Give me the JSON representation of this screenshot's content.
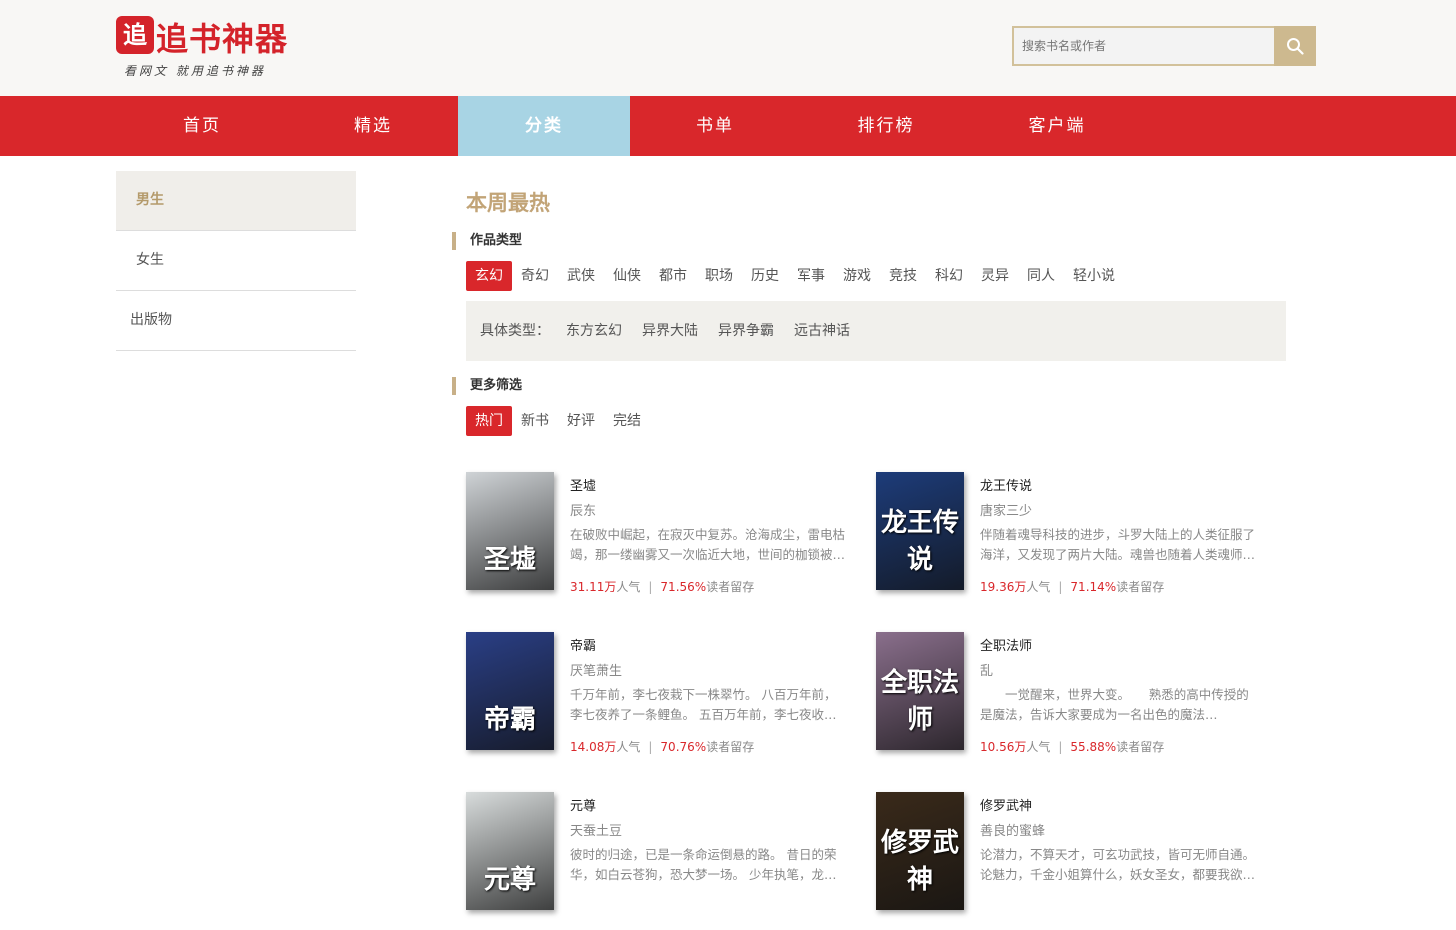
{
  "header": {
    "logo_mark": "追",
    "logo_text": "追书神器",
    "slogan": "看网文 就用追书神器",
    "search_placeholder": "搜索书名或作者"
  },
  "nav": {
    "items": [
      {
        "label": "首页"
      },
      {
        "label": "精选"
      },
      {
        "label": "分类",
        "active": true
      },
      {
        "label": "书单"
      },
      {
        "label": "排行榜"
      },
      {
        "label": "客户端"
      }
    ]
  },
  "sidebar": {
    "items": [
      {
        "label": "男生",
        "active": true
      },
      {
        "label": "女生"
      },
      {
        "label": "出版物"
      }
    ]
  },
  "main": {
    "title": "本周最热",
    "genre_section": "作品类型",
    "genres": [
      "玄幻",
      "奇幻",
      "武侠",
      "仙侠",
      "都市",
      "职场",
      "历史",
      "军事",
      "游戏",
      "竞技",
      "科幻",
      "灵异",
      "同人",
      "轻小说"
    ],
    "active_genre": "玄幻",
    "sub_label": "具体类型：",
    "sub_types": [
      "东方玄幻",
      "异界大陆",
      "异界争霸",
      "远古神话"
    ],
    "filter_section": "更多筛选",
    "filters": [
      "热门",
      "新书",
      "好评",
      "完结"
    ],
    "active_filter": "热门"
  },
  "books": [
    {
      "title": "圣墟",
      "author": "辰东",
      "desc": "在破败中崛起，在寂灭中复苏。沧海成尘，雷电枯竭，那一缕幽雾又一次临近大地，世间的枷锁被打…",
      "popularity": "31.11万",
      "pop_label": "人气",
      "retention": "71.56%",
      "ret_label": "读者留存",
      "cover_text": "圣墟",
      "cover_color": "#cfd3d6"
    },
    {
      "title": "龙王传说",
      "author": "唐家三少",
      "desc": "伴随着魂导科技的进步，斗罗大陆上的人类征服了海洋，又发现了两片大陆。魂兽也随着人类魂师的…",
      "popularity": "19.36万",
      "pop_label": "人气",
      "retention": "71.14%",
      "ret_label": "读者留存",
      "cover_text": "龙王传说",
      "cover_color": "#1d3c7a"
    },
    {
      "title": "帝霸",
      "author": "厌笔萧生",
      "desc": "千万年前，李七夜栽下一株翠竹。 八百万年前，李七夜养了一条鲤鱼。 五百万年前，李七夜收养一个…",
      "popularity": "14.08万",
      "pop_label": "人气",
      "retention": "70.76%",
      "ret_label": "读者留存",
      "cover_text": "帝霸",
      "cover_color": "#2a3f86"
    },
    {
      "title": "全职法师",
      "author": "乱",
      "desc": "　　一觉醒来，世界大变。　　熟悉的高中传授的是魔法，告诉大家要成为一名出色的魔法师。　　…",
      "popularity": "10.56万",
      "pop_label": "人气",
      "retention": "55.88%",
      "ret_label": "读者留存",
      "cover_text": "全职法师",
      "cover_color": "#8a6f8c"
    },
    {
      "title": "元尊",
      "author": "天蚕土豆",
      "desc": "彼时的归途，已是一条命运倒悬的路。 昔日的荣华，如白云苍狗，恐大梦一场。 少年执笔，龙蛇飞…",
      "popularity": "",
      "pop_label": "",
      "retention": "",
      "ret_label": "",
      "cover_text": "元尊",
      "cover_color": "#d8dcdc"
    },
    {
      "title": "修罗武神",
      "author": "善良的蜜蜂",
      "desc": "论潜力，不算天才，可玄功武技，皆可无师自通。论魅力，千金小姐算什么，妖女圣女，都要我欲罢…",
      "popularity": "",
      "pop_label": "",
      "retention": "",
      "ret_label": "",
      "cover_text": "修罗武神",
      "cover_color": "#3a2a1a"
    }
  ]
}
